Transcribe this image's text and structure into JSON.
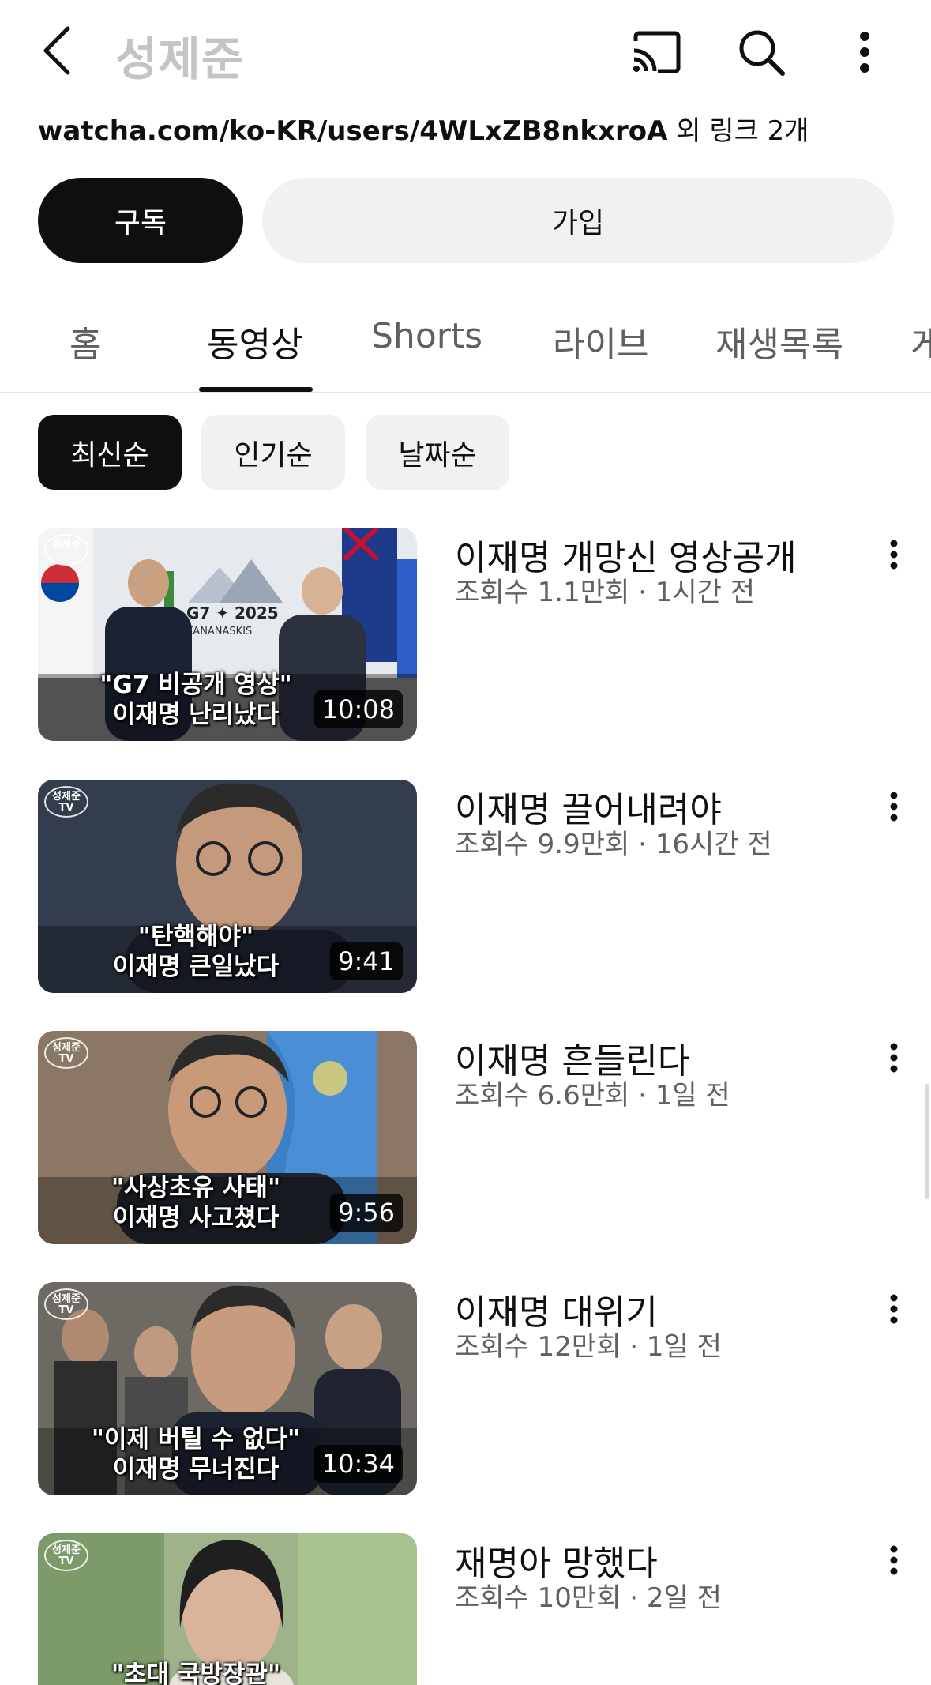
{
  "header": {
    "channel_name": "성제준",
    "icons": [
      "back-arrow-icon",
      "cast-icon",
      "search-icon",
      "more-vert-icon"
    ]
  },
  "channel": {
    "link_url": "watcha.com/ko-KR/users/4WLxZB8nkxroA",
    "link_suffix": " 외 링크 2개"
  },
  "actions": {
    "subscribe_label": "구독",
    "join_label": "가입"
  },
  "tabs": [
    {
      "label": "홈",
      "active": false
    },
    {
      "label": "동영상",
      "active": true
    },
    {
      "label": "Shorts",
      "active": false
    },
    {
      "label": "라이브",
      "active": false
    },
    {
      "label": "재생목록",
      "active": false
    },
    {
      "label": "게",
      "active": false
    }
  ],
  "sort_chips": [
    {
      "label": "최신순",
      "active": true
    },
    {
      "label": "인기순",
      "active": false
    },
    {
      "label": "날짜순",
      "active": false
    }
  ],
  "videos": [
    {
      "title": "이재명 개망신 영상공개",
      "meta": "조회수 1.1만회 · 1시간 전",
      "duration": "10:08",
      "thumb_caption_1": "\"G7 비공개 영상\"",
      "thumb_caption_2": "이재명 난리났다",
      "thumb_sign_1": "G7 ✦ 2025",
      "thumb_sign_2": "KANANASKIS",
      "channel_badge": "성제준"
    },
    {
      "title": "이재명 끌어내려야",
      "meta": "조회수 9.9만회 · 16시간 전",
      "duration": "9:41",
      "thumb_caption_1": "\"탄핵해야\"",
      "thumb_caption_2": "이재명 큰일났다",
      "channel_badge": "성제준 TV"
    },
    {
      "title": "이재명 흔들린다",
      "meta": "조회수 6.6만회 · 1일 전",
      "duration": "9:56",
      "thumb_caption_1": "\"사상초유 사태\"",
      "thumb_caption_2": "이재명 사고쳤다",
      "channel_badge": "성제준 TV"
    },
    {
      "title": "이재명 대위기",
      "meta": "조회수 12만회 · 1일 전",
      "duration": "10:34",
      "thumb_caption_1": "\"이제 버틸 수 없다\"",
      "thumb_caption_2": "이재명 무너진다",
      "channel_badge": "성제준 TV"
    },
    {
      "title": "재명아 망했다",
      "meta": "조회수 10만회 · 2일 전",
      "duration": "",
      "thumb_caption_1": "\"초대 국방장관\"",
      "thumb_caption_2": "",
      "channel_badge": "성제준 TV"
    }
  ],
  "colors": {
    "text_primary": "#0f0f0f",
    "text_secondary": "#606060",
    "chip_inactive_bg": "#f1f1f1",
    "title_muted": "#c4c4c4"
  }
}
